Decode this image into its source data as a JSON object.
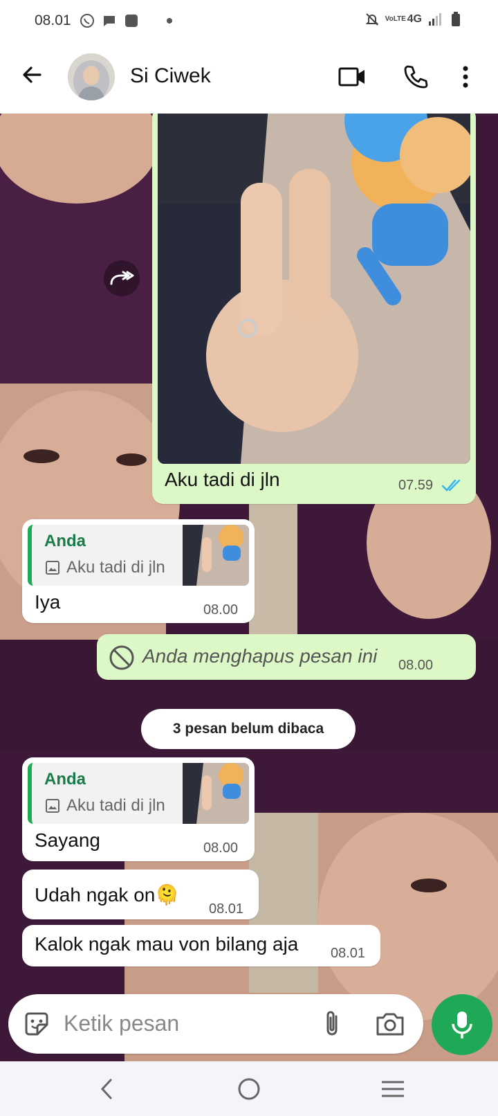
{
  "status_bar": {
    "time": "08.01",
    "network": "4G",
    "volte": "VoLTE"
  },
  "header": {
    "contact_name": "Si Ciwek"
  },
  "messages": [
    {
      "id": "m1",
      "direction": "out",
      "caption": "Aku tadi di jln",
      "time": "07.59",
      "read": true
    },
    {
      "id": "m2",
      "direction": "in",
      "quote_name": "Anda",
      "quote_text": "Aku tadi di jln",
      "text": "Iya",
      "time": "08.00"
    },
    {
      "id": "m3",
      "direction": "out",
      "deleted_text": "Anda menghapus pesan ini",
      "time": "08.00"
    },
    {
      "id": "m5",
      "direction": "in",
      "quote_name": "Anda",
      "quote_text": "Aku tadi di jln",
      "text": "Sayang",
      "time": "08.00"
    },
    {
      "id": "m6",
      "direction": "in",
      "text": "Udah ngak on",
      "emoji": "🫠",
      "time": "08.01"
    },
    {
      "id": "m7",
      "direction": "in",
      "text": "Kalok ngak mau von bilang aja",
      "time": "08.01"
    }
  ],
  "unread_pill": "3 pesan belum dibaca",
  "composer": {
    "placeholder": "Ketik pesan"
  },
  "colors": {
    "accent": "#1fa855",
    "outgoing_bubble": "#dcf8c6",
    "read_ticks": "#34b7f1"
  }
}
